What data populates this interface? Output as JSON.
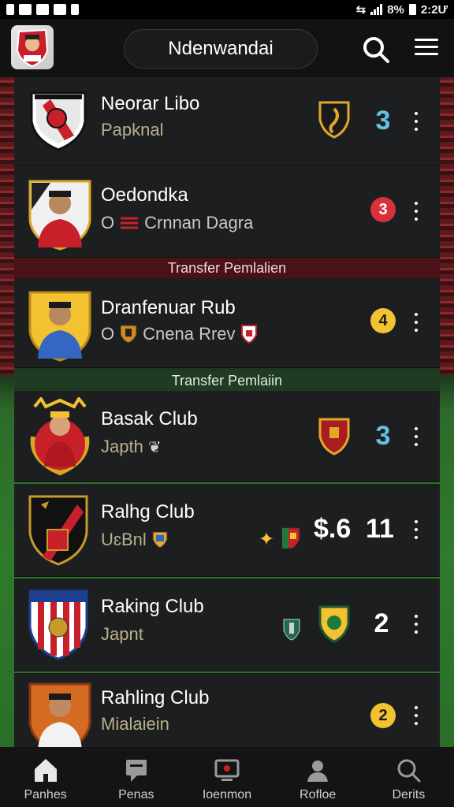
{
  "status_bar": {
    "battery": "8%",
    "time": "2:2Ư"
  },
  "header": {
    "title": "Ndenwandai"
  },
  "clubs": [
    {
      "name": "Neorar Libo",
      "sub": "Papknal",
      "count": "3",
      "count_color": "#62c1e5"
    },
    {
      "name": "Oedondka",
      "sub_prefix": "O",
      "sub": "Crnnan Dagra",
      "count": "3",
      "count_color": "#d9303b"
    },
    {
      "name": "Dranfenuar Rub",
      "sub_prefix": "O",
      "sub": "Cnena Rrev",
      "count": "4",
      "count_color": "#f2c230"
    },
    {
      "name": "Basak Club",
      "sub": "Japth",
      "count": "3",
      "count_color": "#62c1e5"
    },
    {
      "name": "Ralhg Club",
      "sub": "UɛBnl",
      "price": "$.6",
      "count": "11"
    },
    {
      "name": "Raking Club",
      "sub": "Japnt",
      "count": "2"
    },
    {
      "name": "Rahling Club",
      "sub": "Mialaiein",
      "count": "2",
      "count_color": "#f2c230"
    }
  ],
  "dividers": [
    "Transfer Pemlalien",
    "Transfer Pemlaiin"
  ],
  "nav": [
    {
      "label": "Panhes",
      "icon": "home-icon"
    },
    {
      "label": "Penas",
      "icon": "chat-icon"
    },
    {
      "label": "Ioenmon",
      "icon": "tv-icon"
    },
    {
      "label": "Rofloe",
      "icon": "profile-icon"
    },
    {
      "label": "Derits",
      "icon": "search-icon"
    }
  ],
  "colors": {
    "accent_blue": "#62c1e5",
    "accent_red": "#d9303b",
    "accent_yellow": "#f2c230"
  }
}
